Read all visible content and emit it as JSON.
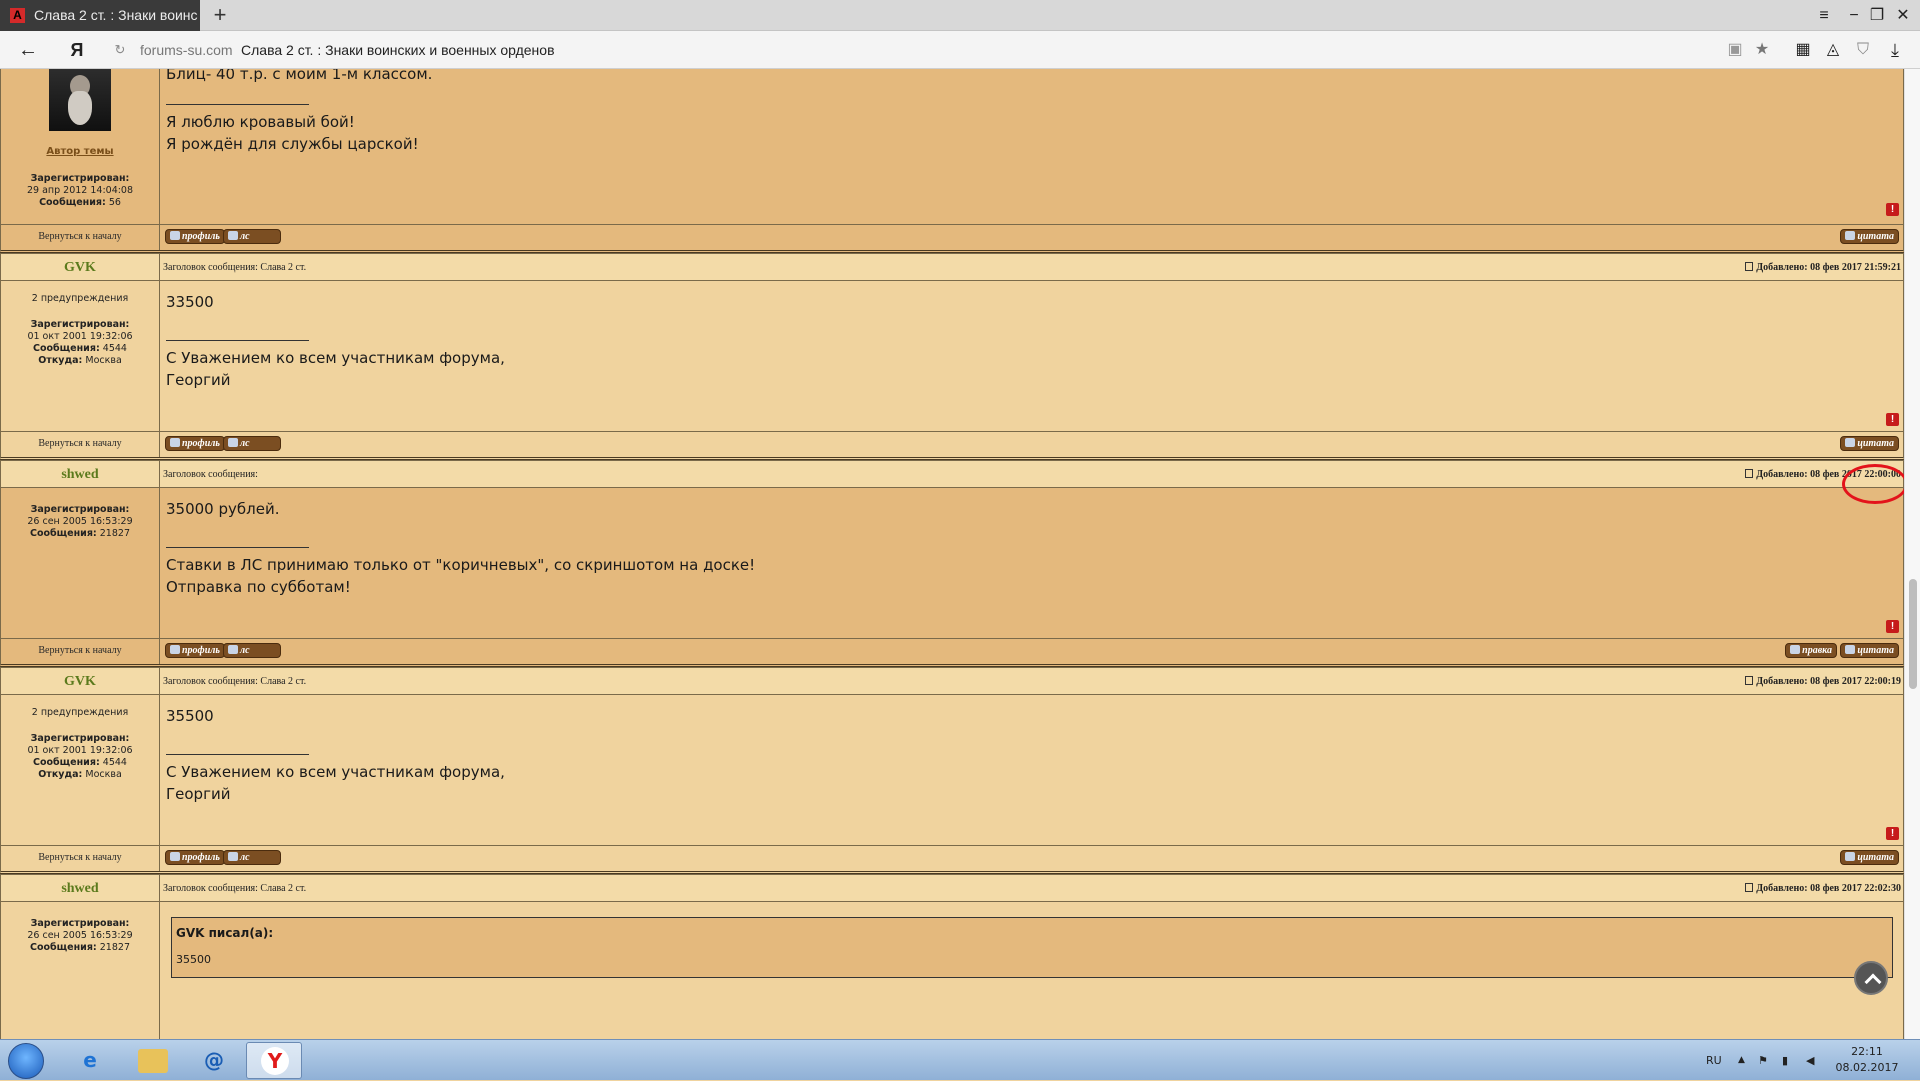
{
  "browser": {
    "tab_title": "Слава 2 ст. : Знаки воинс",
    "tab_favicon": "А",
    "url_host": "forums-su.com",
    "page_title": "Слава 2 ст. : Знаки воинских и военных орденов",
    "yandex_logo": "Я"
  },
  "top_post": {
    "body_lines": [
      "Блиц- 40 т.р. с моим 1-м классом.",
      "Я люблю кровавый бой!",
      "Я рождён для службы царской!"
    ],
    "author_link": "Автор темы",
    "registered_label": "Зарегистрирован:",
    "registered": "29 апр 2012 14:04:08",
    "messages_label": "Сообщения:",
    "messages": "56"
  },
  "posts": [
    {
      "user": "GVK",
      "subject": "Заголовок сообщения: Слава 2 ст.",
      "added": "Добавлено: 08 фев 2017 21:59:21",
      "warnings": "2 предупреждения",
      "registered": "01 окт 2001 19:32:06",
      "messages": "4544",
      "from_label": "Откуда:",
      "from": "Москва",
      "body": "33500",
      "sig_lines": [
        "С Уважением ко всем участникам форума,",
        "Георгий"
      ]
    },
    {
      "user": "shwed",
      "subject": "Заголовок сообщения:",
      "added": "Добавлено: 08 фев 2017 22:00:00",
      "registered": "26 сен 2005 16:53:29",
      "messages": "21827",
      "body": "35000 рублей.",
      "sig_lines": [
        "Ставки в ЛС принимаю только от \"коричневых\", со скриншотом на доске!",
        "Отправка по субботам!"
      ]
    },
    {
      "user": "GVK",
      "subject": "Заголовок сообщения: Слава 2 ст.",
      "added": "Добавлено: 08 фев 2017 22:00:19",
      "warnings": "2 предупреждения",
      "registered": "01 окт 2001 19:32:06",
      "messages": "4544",
      "from_label": "Откуда:",
      "from": "Москва",
      "body": "35500",
      "sig_lines": [
        "С Уважением ко всем участникам форума,",
        "Георгий"
      ]
    },
    {
      "user": "shwed",
      "subject": "Заголовок сообщения: Слава 2 ст.",
      "added": "Добавлено: 08 фев 2017 22:02:30",
      "registered": "26 сен 2005 16:53:29",
      "messages": "21827",
      "quote_header": "GVK писал(а):",
      "quote_text": "35500"
    }
  ],
  "labels": {
    "registered": "Зарегистрирован:",
    "messages": "Сообщения:",
    "back_to_top": "Вернуться к началу",
    "profile": "профиль",
    "pm": "лс",
    "quote": "цитата",
    "edit": "правка",
    "report": "!"
  },
  "taskbar": {
    "lang": "RU",
    "time": "22:11",
    "date": "08.02.2017"
  },
  "colors": {
    "annotation": "#e3131b",
    "username": "#5b7a1c",
    "post_bg_dark": "#e4b97d",
    "post_bg_light": "#f0d39e"
  }
}
